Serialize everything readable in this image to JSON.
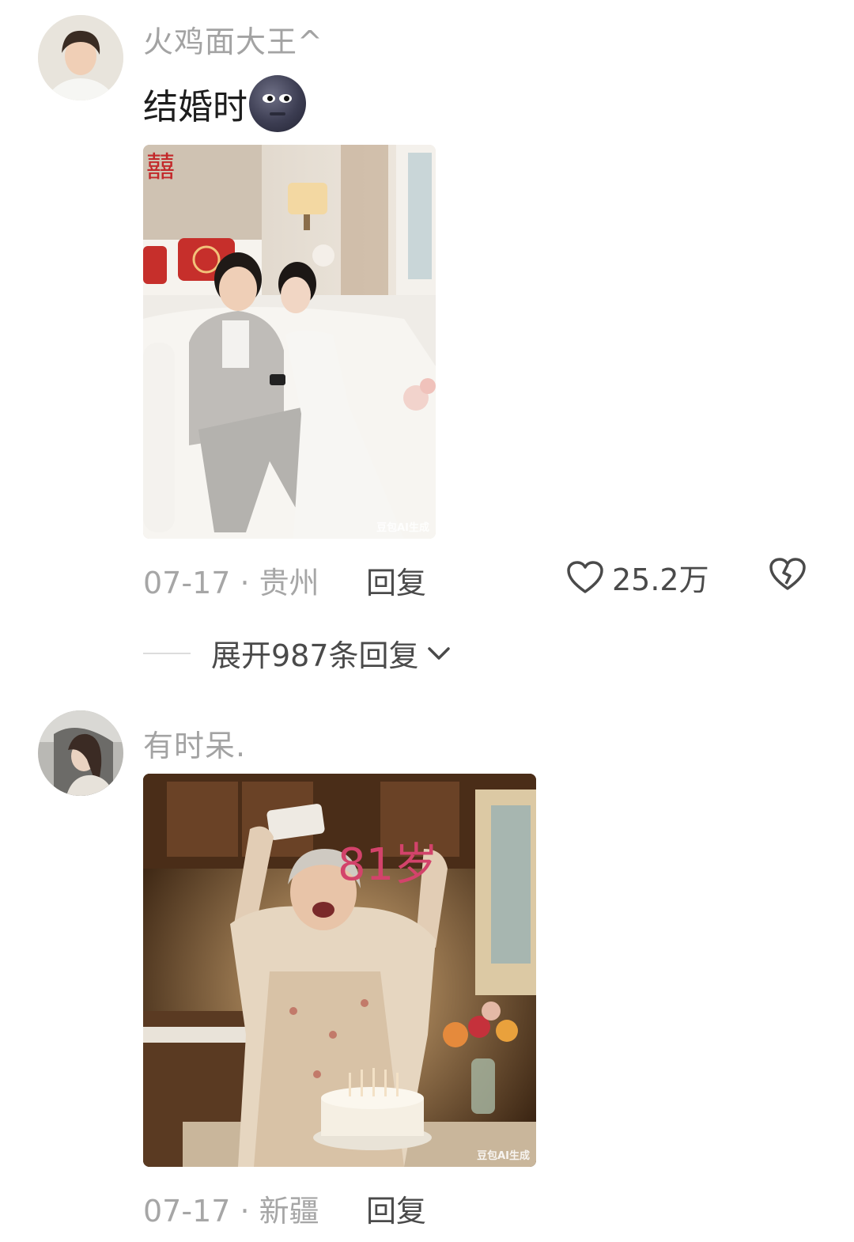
{
  "comments": [
    {
      "username": "火鸡面大王^",
      "text": "结婚时",
      "emoji": "new-moon-face-emoji",
      "date_location": "07-17 · 贵州",
      "reply_label": "回复",
      "likes": "25.2万",
      "expand_label": "展开987条回复",
      "photo_watermark": "豆包AI生成"
    },
    {
      "username": "有时呆.",
      "date_location": "07-17 · 新疆",
      "reply_label": "回复",
      "photo_overlay_text": "81岁",
      "photo_watermark": "豆包AI生成"
    }
  ],
  "colors": {
    "username": "#a3a3a3",
    "meta": "#a6a6a6",
    "action": "#4a4a4a",
    "accent_overlay": "#d3436b"
  }
}
